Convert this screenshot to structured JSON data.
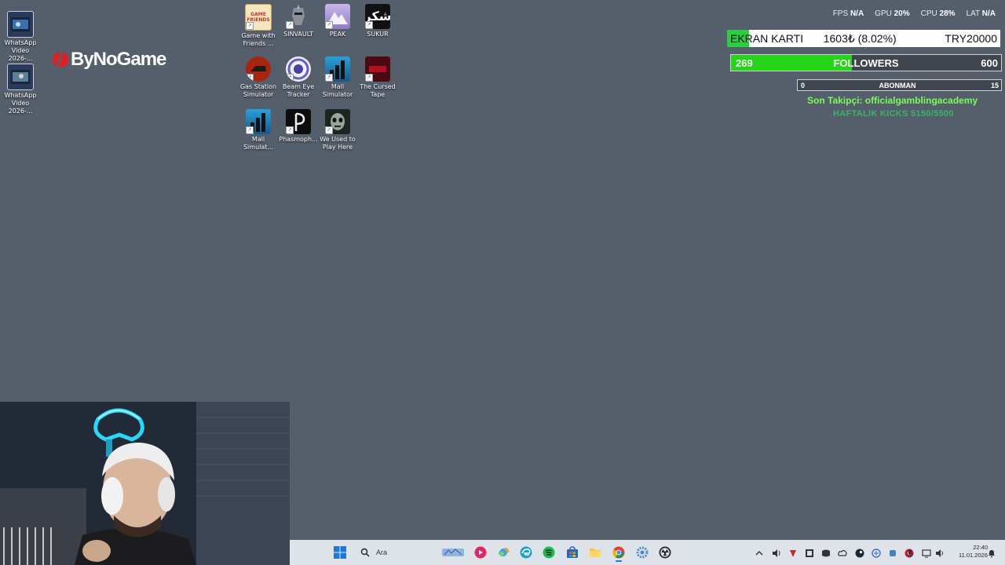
{
  "desktop": {
    "icons_left": [
      {
        "label_line1": "WhatsApp",
        "label_line2": "Video 2026-..."
      },
      {
        "label_line1": "WhatsApp",
        "label_line2": "Video 2026-..."
      }
    ],
    "icons_grid": [
      {
        "label_line1": "Game with",
        "label_line2": "Friends ..."
      },
      {
        "label_line1": "SINVAULT",
        "label_line2": ""
      },
      {
        "label_line1": "PEAK",
        "label_line2": ""
      },
      {
        "label_line1": "SUKUR",
        "label_line2": ""
      },
      {
        "label_line1": "Gas Station",
        "label_line2": "Simulator"
      },
      {
        "label_line1": "Beam Eye",
        "label_line2": "Tracker"
      },
      {
        "label_line1": "Mall",
        "label_line2": "Simulator"
      },
      {
        "label_line1": "The Cursed",
        "label_line2": "Tape"
      },
      {
        "label_line1": "Mall",
        "label_line2": "Simulat..."
      },
      {
        "label_line1": "Phasmoph...",
        "label_line2": ""
      },
      {
        "label_line1": "We Used to",
        "label_line2": "Play Here"
      }
    ],
    "sukur_glyph": "شكر"
  },
  "logo": {
    "text": "ByNoGame"
  },
  "overlay": {
    "stats": {
      "fps_label": "FPS",
      "fps_value": "N/A",
      "gpu_label": "GPU",
      "gpu_value": "20%",
      "cpu_label": "CPU",
      "cpu_value": "28%",
      "lat_label": "LAT",
      "lat_value": "N/A"
    },
    "goal": {
      "title": "EKRAN KARTI",
      "amount": "1603₺ (8.02%)",
      "target": "TRY20000",
      "progress": 0.0802
    },
    "followers": {
      "current": "269",
      "label": "FOLLOWERS",
      "target": "600",
      "progress": 0.448
    },
    "subs": {
      "current": "0",
      "label": "ABONMAN",
      "target": "15",
      "progress": 0
    },
    "last_follower": "Son Takipçi: officialgamblingacademy",
    "weekly_kicks": "HAFTALIK KICKS 5150/5500"
  },
  "taskbar": {
    "search_placeholder": "Ara",
    "clock_time": "22:40",
    "clock_date": "11.01.2026"
  },
  "colors": {
    "desktop": "#555e6b",
    "taskbar": "#dee3ea",
    "goal_fill": "#2ecc40",
    "follow_fill": "#26d41a",
    "follower_text": "#7cfc5a"
  }
}
